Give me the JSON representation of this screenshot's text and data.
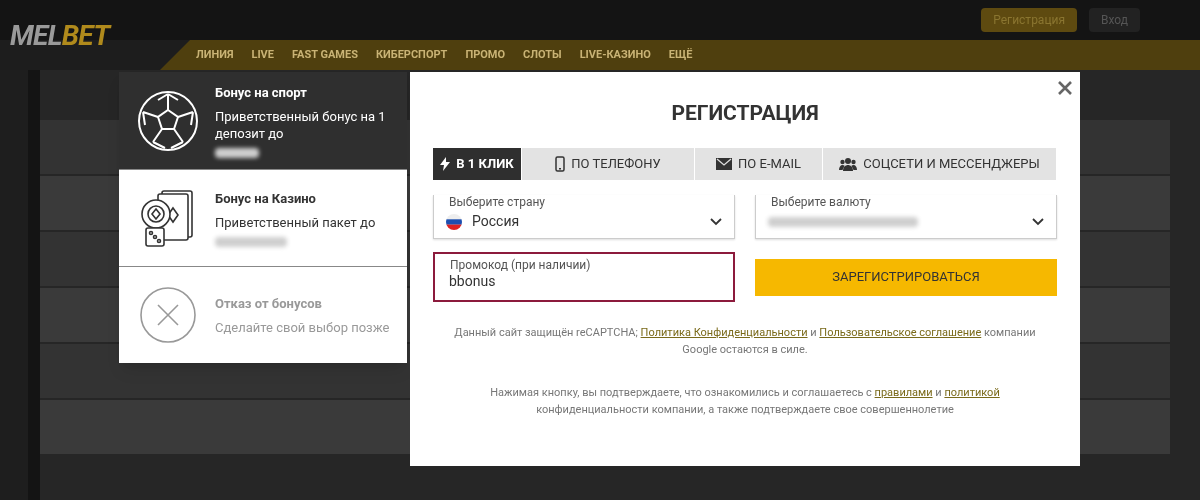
{
  "header": {
    "logo": {
      "first": "MEL",
      "second": "BET"
    },
    "buttons": [
      {
        "label": "Регистрация",
        "kind": "primary"
      },
      {
        "label": "Вход",
        "kind": "secondary"
      }
    ],
    "nav": [
      "ЛИНИЯ",
      "LIVE",
      "FAST GAMES",
      "КИБЕРСПОРТ",
      "ПРОМО",
      "СЛОТЫ",
      "LIVE-КАЗИНО",
      "ЕЩЁ"
    ]
  },
  "bonus_panel": {
    "options": [
      {
        "kind": "sport",
        "title": "Бонус на спорт",
        "subtitle": "Приветственный бонус на 1 депозит до",
        "selected": true
      },
      {
        "kind": "casino",
        "title": "Бонус на Казино",
        "subtitle": "Приветственный пакет до",
        "selected": false
      },
      {
        "kind": "decline",
        "title": "Отказ от бонусов",
        "subtitle": "Сделайте свой выбор позже",
        "selected": false
      }
    ]
  },
  "modal": {
    "title": "РЕГИСТРАЦИЯ",
    "tabs": [
      {
        "kind": "bolt",
        "label": "В 1 КЛИК",
        "selected": true
      },
      {
        "kind": "phone",
        "label": "ПО ТЕЛЕФОНУ",
        "selected": false
      },
      {
        "kind": "mail",
        "label": "ПО E-MAIL",
        "selected": false
      },
      {
        "kind": "people",
        "label": "СОЦСЕТИ И МЕССЕНДЖЕРЫ",
        "selected": false
      }
    ],
    "country": {
      "label": "Выберите страну",
      "value": "Россия"
    },
    "currency": {
      "label": "Выберите валюту"
    },
    "promo": {
      "label": "Промокод (при наличии)",
      "value": "bbonus",
      "highlighted": true
    },
    "register_button": "ЗАРЕГИСТРИРОВАТЬСЯ",
    "notes": [
      [
        {
          "kind": "text",
          "text": "Данный сайт защищён reCAPTCHA; "
        },
        {
          "kind": "link",
          "text": "Политика Конфиденциальности"
        },
        {
          "kind": "text",
          "text": " и "
        },
        {
          "kind": "link",
          "text": "Пользовательское соглашение"
        },
        {
          "kind": "text",
          "text": " компании Google остаются в силе."
        }
      ],
      [
        {
          "kind": "text",
          "text": "Нажимая кнопку, вы подтверждаете, что ознакомились и соглашаетесь с "
        },
        {
          "kind": "link",
          "text": "правилами"
        },
        {
          "kind": "text",
          "text": " и "
        },
        {
          "kind": "link",
          "text": "политикой"
        },
        {
          "kind": "text",
          "text": " конфиденциальности компании, а также подтверждаете свое совершеннолетие"
        }
      ]
    ]
  }
}
